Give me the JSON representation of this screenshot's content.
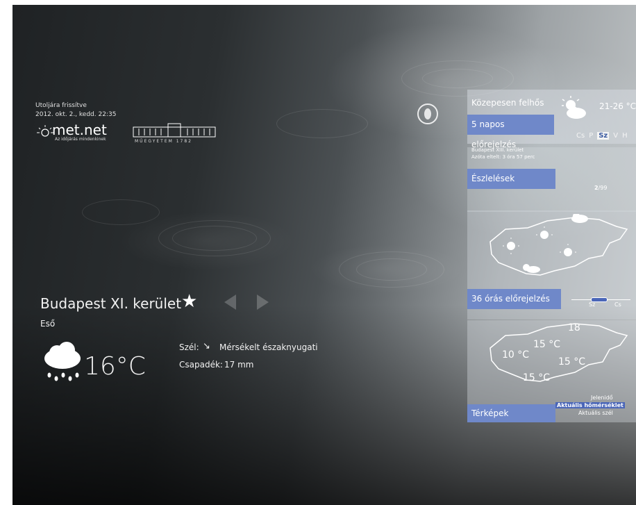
{
  "header": {
    "last_updated_label": "Utoljára frissítve",
    "last_updated_value": "2012. okt. 2., kedd. 22:35",
    "logo1_text": "met.net",
    "logo1_sub": "Az időjárás mindenkinek",
    "logo2_sub": "MŰEGYETEM 1782"
  },
  "main": {
    "location": "Budapest XI. kerület",
    "condition": "Eső",
    "temperature": "16°C",
    "wind_label": "Szél:",
    "wind_value": "Mérsékelt északnyugati",
    "precip_label": "Csapadék:",
    "precip_value": "17 mm"
  },
  "forecast_tile": {
    "condition": "Közepesen felhős",
    "temp_range": "21-26 °C",
    "label": "5 napos előrejelzés",
    "days": [
      "Cs",
      "P",
      "Sz",
      "V",
      "H"
    ],
    "selected_day": "Sz"
  },
  "obs_tile": {
    "station": "Budapest XIII. kerület",
    "elapsed": "Azóta eltelt: 3 óra 57 perc",
    "label": "Észlelések",
    "page_current": "2",
    "page_total": "/99"
  },
  "forecast36_tile": {
    "label": "36 órás előrejelzés",
    "slider_start": "Sz",
    "slider_end": "Cs"
  },
  "maps_tile": {
    "label": "Térképek",
    "temps": [
      "18",
      "15 °C",
      "10 °C",
      "15 °C",
      "15 °C"
    ],
    "options": [
      "Jelenidő",
      "Aktuális hőmérséklet",
      "Aktuális szél"
    ],
    "selected_option": "Aktuális hőmérséklet"
  },
  "icons": {
    "favorite": "star-icon",
    "prev": "arrow-left-icon",
    "next": "arrow-right-icon",
    "wind_dir": "arrow-down-right-icon",
    "weather": "rain-cloud-icon",
    "settings": "face-icon"
  }
}
